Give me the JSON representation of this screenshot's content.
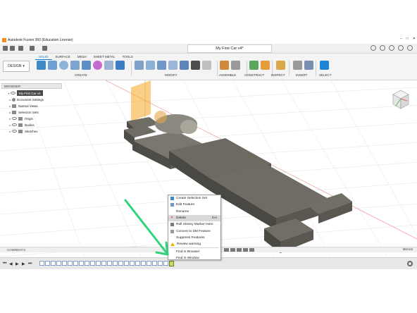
{
  "window": {
    "title": "Autodesk Fusion 360 (Education License)",
    "document_tab": "My First Car v4*"
  },
  "workspace": {
    "button_label": "DESIGN",
    "tabs": [
      "SOLID",
      "SURFACE",
      "MESH",
      "SHEET METAL",
      "TOOLS"
    ],
    "active_tab": "SOLID",
    "groups": [
      "CREATE",
      "MODIFY",
      "ASSEMBLE",
      "CONSTRUCT",
      "INSPECT",
      "INSERT",
      "SELECT"
    ]
  },
  "browser": {
    "header": "BROWSER",
    "root": "My First Car v4",
    "items": [
      "Document Settings",
      "Named Views",
      "Selection Sets",
      "Origin",
      "Bodies",
      "Sketches"
    ]
  },
  "bottom": {
    "comments_label": "COMMENTS",
    "mirror_label": "Mirror2"
  },
  "context_menu": {
    "items": [
      {
        "label": "Create Selection Set",
        "shortcut": ""
      },
      {
        "label": "Edit Feature",
        "shortcut": ""
      },
      {
        "label": "Rename",
        "shortcut": ""
      },
      {
        "label": "Delete",
        "shortcut": "Del"
      },
      {
        "label": "Roll History Marker Here",
        "shortcut": ""
      },
      {
        "label": "Convert to DM Feature",
        "shortcut": ""
      },
      {
        "label": "Suppress Features",
        "shortcut": ""
      },
      {
        "label": "Review warning",
        "shortcut": ""
      },
      {
        "label": "Find in Browser",
        "shortcut": ""
      },
      {
        "label": "Find in Window",
        "shortcut": ""
      }
    ],
    "highlighted": "Delete"
  },
  "colors": {
    "accent": "#0b7ad1",
    "annotation_arrow": "#2fd37a",
    "model_body": "#5e5b54",
    "sketch_plane": "#f5a623",
    "warning_marker": "#cbd86a"
  }
}
